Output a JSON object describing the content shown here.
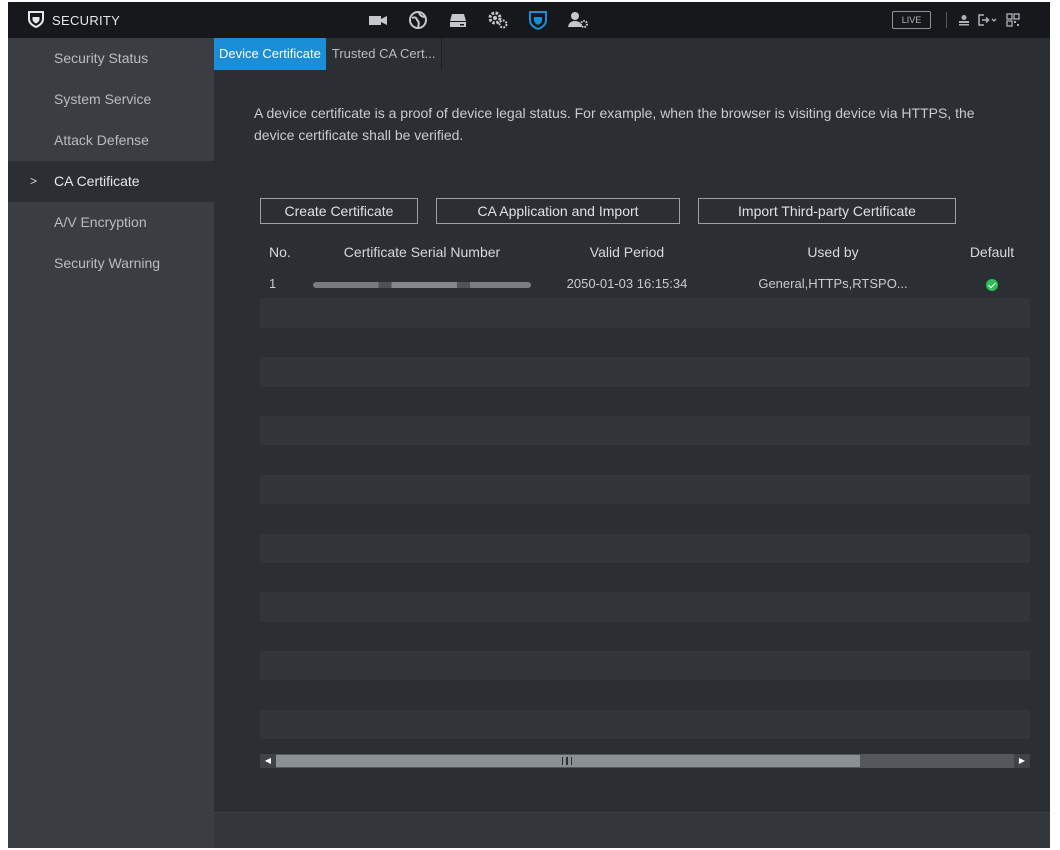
{
  "header": {
    "title": "SECURITY",
    "module_icons": [
      "camera-icon",
      "network-icon",
      "storage-icon",
      "system-settings-icon",
      "security-icon",
      "account-icon"
    ],
    "live_label": "LIVE",
    "system_icons": [
      "user-icon",
      "logout-icon",
      "qr-code-icon"
    ]
  },
  "sidebar": {
    "items": [
      {
        "label": "Security Status"
      },
      {
        "label": "System Service"
      },
      {
        "label": "Attack Defense"
      },
      {
        "label": "CA Certificate"
      },
      {
        "label": "A/V Encryption"
      },
      {
        "label": "Security Warning"
      }
    ],
    "active_index": 3
  },
  "tabs": [
    {
      "label": "Device Certificate"
    },
    {
      "label": "Trusted CA Cert..."
    }
  ],
  "main": {
    "description": "A device certificate is a proof of device legal status. For example, when the browser is visiting device via HTTPS, the device certificate shall be verified.",
    "buttons": {
      "create": "Create Certificate",
      "ca_application": "CA Application and Import",
      "import_third_party": "Import Third-party Certificate"
    },
    "table": {
      "columns": [
        "No.",
        "Certificate Serial Number",
        "Valid Period",
        "Used by",
        "Default"
      ],
      "rows": [
        {
          "no": "1",
          "serial_masked": true,
          "valid_period": "2050-01-03 16:15:34",
          "used_by": "General,HTTPs,RTSPO...",
          "default": true
        }
      ]
    }
  },
  "colors": {
    "accent": "#1a8fd8",
    "check": "#2dbd5a",
    "background": "#2b2e33",
    "sidebar": "#3a3e43",
    "topbar": "#16181b"
  }
}
